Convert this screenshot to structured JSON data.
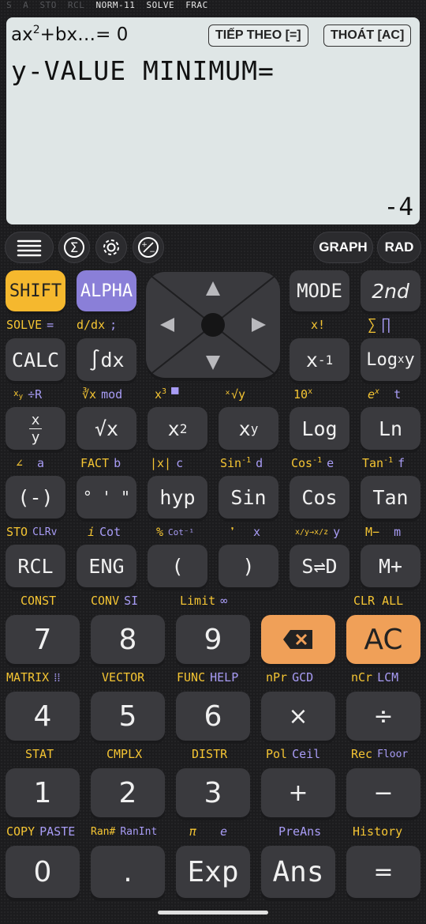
{
  "status_bar": {
    "items": [
      "S",
      "A",
      "STO",
      "RCL",
      "NORM-11",
      "SOLVE",
      "FRAC"
    ]
  },
  "display": {
    "equation_prefix": "ax",
    "equation_sup": "2",
    "equation_suffix": "+bx…= 0",
    "next_button": "TIẾP THEO [=]",
    "exit_button": "THOÁT [AC]",
    "prompt": "y-VALUE MINIMUM=",
    "result": "-4"
  },
  "toolbar": {
    "graph": "GRAPH",
    "rad": "RAD"
  },
  "keys": {
    "shift": "SHIFT",
    "alpha": "ALPHA",
    "mode": "MODE",
    "second": "2nd",
    "calc": "CALC",
    "integral": "∫dx",
    "inverse_base": "x",
    "inverse_sup": "-1",
    "log_x_y_a": "Log",
    "log_x_y_sub": "x",
    "log_x_y_b": "y",
    "frac_top": "x",
    "frac_bottom": "y",
    "sqrt": "√x",
    "square_base": "x",
    "square_sup": "2",
    "power_base": "x",
    "power_sup": "y",
    "log": "Log",
    "ln": "Ln",
    "neg": "(-)",
    "dms": "° ' \"",
    "hyp": "hyp",
    "sin": "Sin",
    "cos": "Cos",
    "tan": "Tan",
    "rcl": "RCL",
    "eng": "ENG",
    "lparen": "(",
    "rparen": ")",
    "sd": "S⇌D",
    "mplus": "M+",
    "n7": "7",
    "n8": "8",
    "n9": "9",
    "ac": "AC",
    "n4": "4",
    "n5": "5",
    "n6": "6",
    "mul": "×",
    "div": "÷",
    "n1": "1",
    "n2": "2",
    "n3": "3",
    "add": "+",
    "sub": "−",
    "n0": "0",
    "dot": ".",
    "exp": "Exp",
    "ans": "Ans",
    "equals": "="
  },
  "labels": {
    "r1_solve": "SOLVE",
    "r1_eq": "=",
    "r1_ddx": "d/dx",
    "r1_semicolon": ";",
    "r1_xfact": "x!",
    "r1_sigma": "∑",
    "r1_pi": "∏",
    "r2_xy": "x",
    "r2_xy_sub": "y",
    "r2_rdiv": "÷R",
    "r2_cbrt": "∛x",
    "r2_mod": "mod",
    "r2_cube_base": "x",
    "r2_cube_sup": "3",
    "r2_bar": "▀",
    "r2_root": "ˣ√y",
    "r2_ten_base": "10",
    "r2_ten_sup": "x",
    "r2_e_base": "e",
    "r2_e_sup": "x",
    "r2_t": "t",
    "r3_angle": "∠",
    "r3_a": "a",
    "r3_fact": "FACT",
    "r3_b": "b",
    "r3_abs": "|x|",
    "r3_c": "c",
    "r3_asin": "Sin",
    "r3_asin_sup": "-1",
    "r3_d": "d",
    "r3_acos": "Cos",
    "r3_acos_sup": "-1",
    "r3_e": "e",
    "r3_atan": "Tan",
    "r3_atan_sup": "-1",
    "r3_f": "f",
    "r4_sto": "STO",
    "r4_clrv": "CLRv",
    "r4_i": "i",
    "r4_cot": "Cot",
    "r4_pct": "%",
    "r4_acot": "Cot⁻¹",
    "r4_comma": "❜",
    "r4_x": "x",
    "r4_conv": "x/y→x/z",
    "r4_y": "y",
    "r4_mminus": "M−",
    "r4_m": "m",
    "r5_const": "CONST",
    "r5_conv": "CONV",
    "r5_si": "SI",
    "r5_limit": "Limit",
    "r5_inf": "∞",
    "r5_clrall": "CLR ALL",
    "r6_matrix": "MATRIX",
    "r6_matrix_icon": "⁞⁞",
    "r6_vector": "VECTOR",
    "r6_func": "FUNC",
    "r6_help": "HELP",
    "r6_npr": "nPr",
    "r6_gcd": "GCD",
    "r6_ncr": "nCr",
    "r6_lcm": "LCM",
    "r7_stat": "STAT",
    "r7_cmplx": "CMPLX",
    "r7_distr": "DISTR",
    "r7_pol": "Pol",
    "r7_ceil": "Ceil",
    "r7_rec": "Rec",
    "r7_floor": "Floor",
    "r8_copy": "COPY",
    "r8_paste": "PASTE",
    "r8_ran": "Ran#",
    "r8_ranint": "RanInt",
    "r8_pi": "π",
    "r8_e": "e",
    "r8_preans": "PreAns",
    "r8_history": "History"
  }
}
